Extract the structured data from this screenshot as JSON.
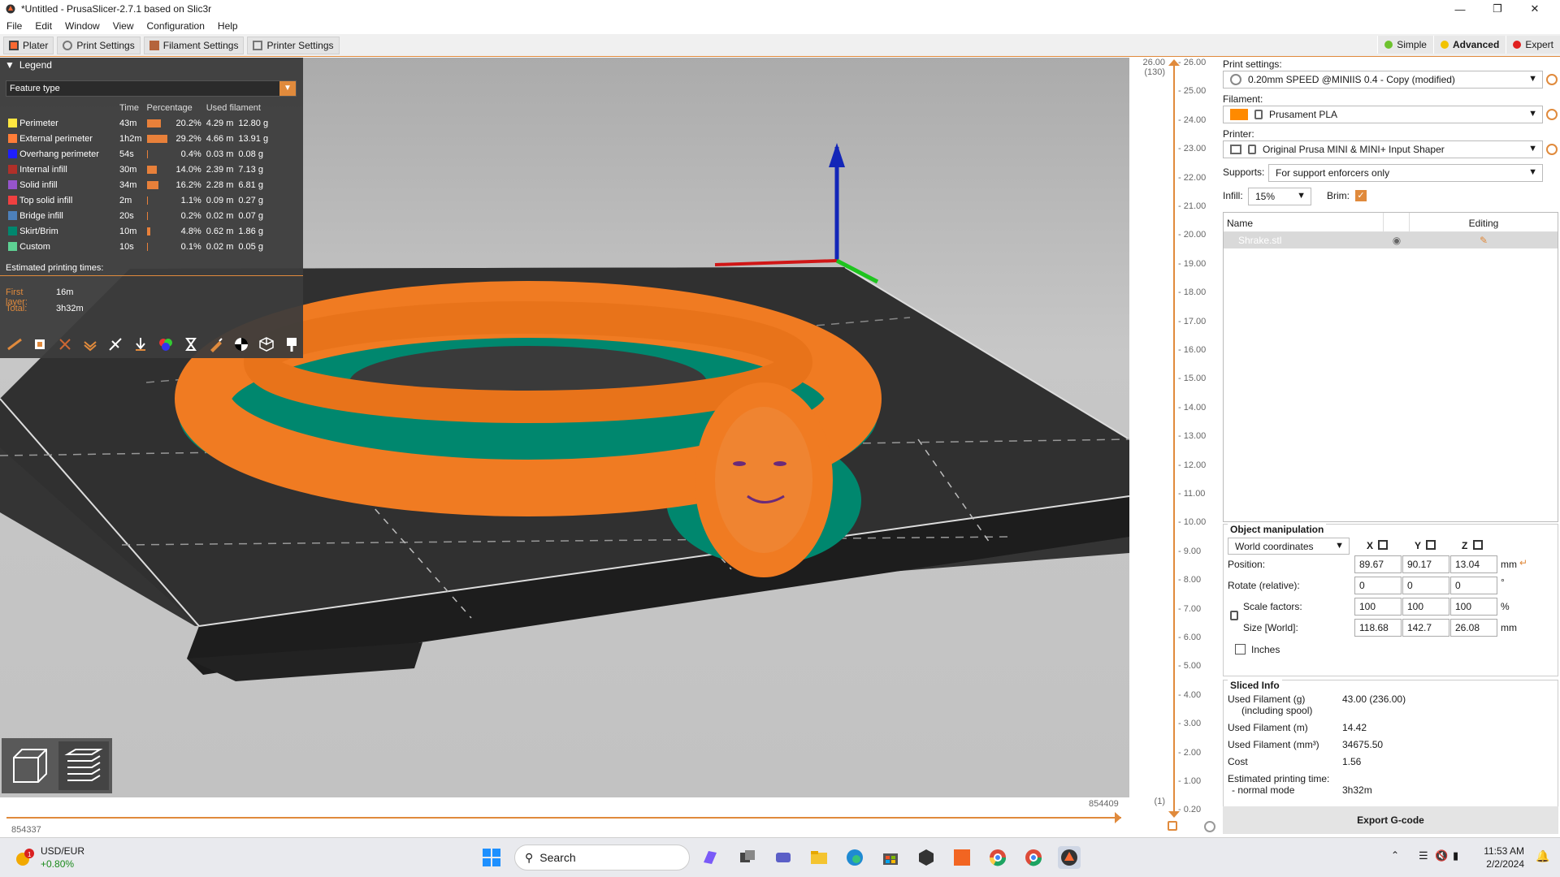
{
  "window": {
    "title": "*Untitled - PrusaSlicer-2.7.1 based on Slic3r"
  },
  "menu": [
    "File",
    "Edit",
    "Window",
    "View",
    "Configuration",
    "Help"
  ],
  "tabs": [
    {
      "label": "Plater",
      "icon": "plater-icon"
    },
    {
      "label": "Print Settings",
      "icon": "print-settings-icon"
    },
    {
      "label": "Filament Settings",
      "icon": "filament-settings-icon"
    },
    {
      "label": "Printer Settings",
      "icon": "printer-settings-icon"
    }
  ],
  "modes": [
    {
      "label": "Simple",
      "color": "#6dc22d"
    },
    {
      "label": "Advanced",
      "color": "#f2c300"
    },
    {
      "label": "Expert",
      "color": "#e0201f"
    }
  ],
  "legend": {
    "header": "Legend",
    "view_type": "Feature type",
    "columns": [
      "Time",
      "Percentage",
      "Used filament"
    ],
    "rows": [
      {
        "name": "Perimeter",
        "color": "#ffe640",
        "time": "43m",
        "pct": 20.2,
        "pct_text": "20.2%",
        "len": "4.29 m",
        "weight": "12.80 g"
      },
      {
        "name": "External perimeter",
        "color": "#ff7d38",
        "time": "1h2m",
        "pct": 29.2,
        "pct_text": "29.2%",
        "len": "4.66 m",
        "weight": "13.91 g"
      },
      {
        "name": "Overhang perimeter",
        "color": "#1f1fff",
        "time": "54s",
        "pct": 0.4,
        "pct_text": "0.4%",
        "len": "0.03 m",
        "weight": "0.08 g"
      },
      {
        "name": "Internal infill",
        "color": "#b03029",
        "time": "30m",
        "pct": 14.0,
        "pct_text": "14.0%",
        "len": "2.39 m",
        "weight": "7.13 g"
      },
      {
        "name": "Solid infill",
        "color": "#9654cc",
        "time": "34m",
        "pct": 16.2,
        "pct_text": "16.2%",
        "len": "2.28 m",
        "weight": "6.81 g"
      },
      {
        "name": "Top solid infill",
        "color": "#f04040",
        "time": "2m",
        "pct": 1.1,
        "pct_text": "1.1%",
        "len": "0.09 m",
        "weight": "0.27 g"
      },
      {
        "name": "Bridge infill",
        "color": "#4d80ba",
        "time": "20s",
        "pct": 0.2,
        "pct_text": "0.2%",
        "len": "0.02 m",
        "weight": "0.07 g"
      },
      {
        "name": "Skirt/Brim",
        "color": "#00876e",
        "time": "10m",
        "pct": 4.8,
        "pct_text": "4.8%",
        "len": "0.62 m",
        "weight": "1.86 g"
      },
      {
        "name": "Custom",
        "color": "#5ed194",
        "time": "10s",
        "pct": 0.1,
        "pct_text": "0.1%",
        "len": "0.02 m",
        "weight": "0.05 g"
      }
    ],
    "estimated_title": "Estimated printing times:",
    "first_layer_label": "First layer:",
    "first_layer": "16m",
    "total_label": "Total:",
    "total": "3h32m"
  },
  "vslider": {
    "top_value": "26.00",
    "top_layer": "(130)",
    "bottom_value": "0.20",
    "bottom_layer": "(1)",
    "ticks": [
      "26.00",
      "25.00",
      "24.00",
      "23.00",
      "22.00",
      "21.00",
      "20.00",
      "19.00",
      "18.00",
      "17.00",
      "16.00",
      "15.00",
      "14.00",
      "13.00",
      "12.00",
      "11.00",
      "10.00",
      "9.00",
      "8.00",
      "7.00",
      "6.00",
      "5.00",
      "4.00",
      "3.00",
      "2.00",
      "1.00",
      "0.20"
    ]
  },
  "hslider": {
    "left_value": "854337",
    "right_value": "854409"
  },
  "panel": {
    "print_settings_label": "Print settings:",
    "print_settings_value": "0.20mm SPEED @MINIIS 0.4 - Copy (modified)",
    "filament_label": "Filament:",
    "filament_value": "Prusament PLA",
    "filament_color": "#ff8a00",
    "printer_label": "Printer:",
    "printer_value": "Original Prusa MINI & MINI+ Input Shaper",
    "supports_label": "Supports:",
    "supports_value": "For support enforcers only",
    "infill_label": "Infill:",
    "infill_value": "15%",
    "brim_label": "Brim:",
    "list_col_name": "Name",
    "list_col_editing": "Editing",
    "object_name": "Shrake.stl"
  },
  "object_manipulation": {
    "title": "Object manipulation",
    "coords": "World coordinates",
    "axes": [
      "X",
      "Y",
      "Z"
    ],
    "position_label": "Position:",
    "position": [
      "89.67",
      "90.17",
      "13.04"
    ],
    "position_unit": "mm",
    "rotate_label": "Rotate (relative):",
    "rotate": [
      "0",
      "0",
      "0"
    ],
    "rotate_unit": "°",
    "scale_label": "Scale factors:",
    "scale": [
      "100",
      "100",
      "100"
    ],
    "scale_unit": "%",
    "size_label": "Size [World]:",
    "size": [
      "118.68",
      "142.7",
      "26.08"
    ],
    "size_unit": "mm",
    "inches_label": "Inches"
  },
  "sliced_info": {
    "title": "Sliced Info",
    "rows": [
      {
        "label": "Used Filament (g)",
        "sub": "(including spool)",
        "value": "43.00 (236.00)"
      },
      {
        "label": "Used Filament (m)",
        "value": "14.42"
      },
      {
        "label": "Used Filament (mm³)",
        "value": "34675.50"
      },
      {
        "label": "Cost",
        "value": "1.56"
      },
      {
        "label": "Estimated printing time:",
        "sub": "- normal mode",
        "value": "3h32m"
      }
    ],
    "export_label": "Export G-code"
  },
  "taskbar": {
    "weather_pair": "USD/EUR",
    "weather_change": "+0.80%",
    "search_placeholder": "Search",
    "time": "11:53 AM",
    "date": "2/2/2024"
  }
}
